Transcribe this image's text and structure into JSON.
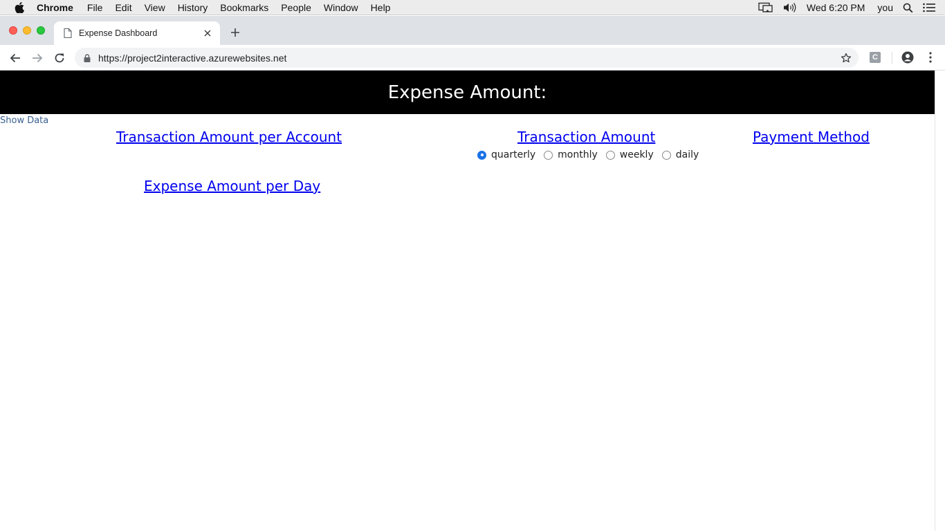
{
  "menubar": {
    "app_name": "Chrome",
    "items": [
      "File",
      "Edit",
      "View",
      "History",
      "Bookmarks",
      "People",
      "Window",
      "Help"
    ],
    "clock": "Wed 6:20 PM",
    "user": "you"
  },
  "browser": {
    "tab_title": "Expense Dashboard",
    "url": "https://project2interactive.azurewebsites.net",
    "extension_label": "C"
  },
  "page": {
    "banner_title": "Expense Amount:",
    "show_data": "Show Data",
    "links": {
      "transaction_per_account": "Transaction Amount per Account",
      "transaction_amount": "Transaction Amount",
      "payment_method": "Payment Method",
      "expense_per_day": "Expense Amount per Day"
    },
    "period_options": [
      {
        "label": "quarterly",
        "checked": true
      },
      {
        "label": "monthly",
        "checked": false
      },
      {
        "label": "weekly",
        "checked": false
      },
      {
        "label": "daily",
        "checked": false
      }
    ]
  }
}
